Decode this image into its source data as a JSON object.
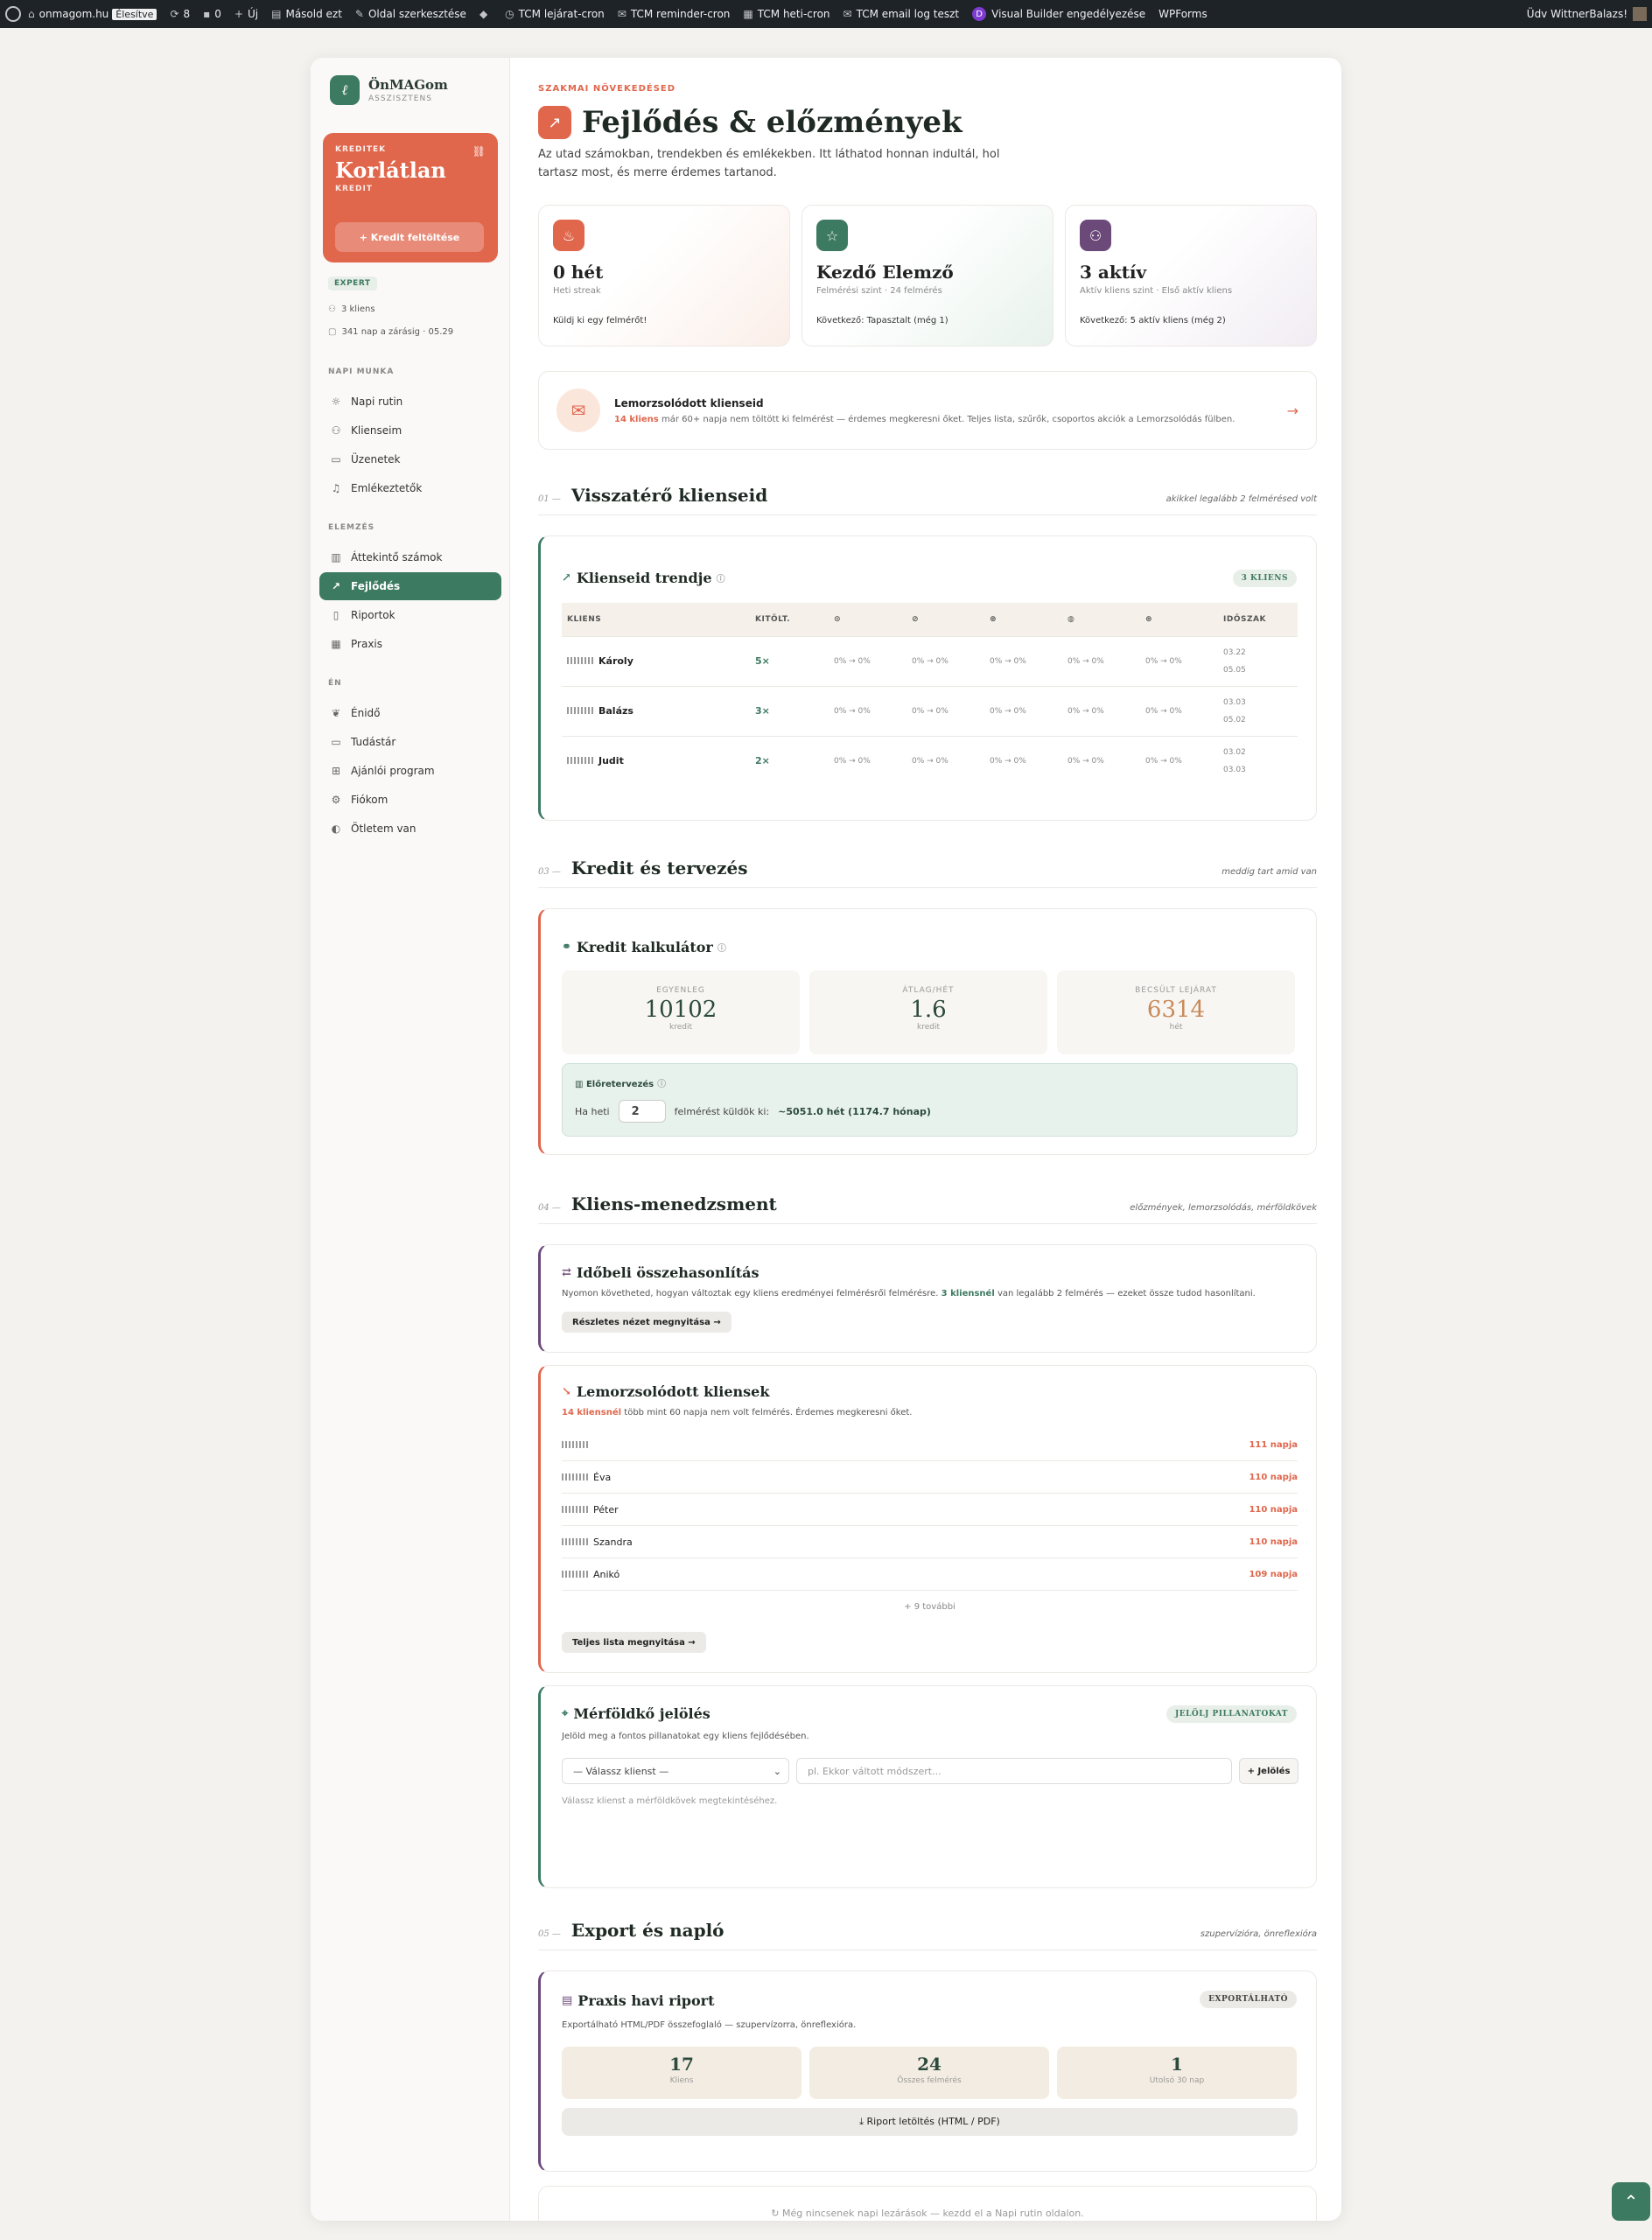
{
  "adminbar": {
    "site": "onmagom.hu",
    "live": "Élesítve",
    "updates": "8",
    "comments": "0",
    "new": "Új",
    "copy": "Másold ezt",
    "edit": "Oldal szerkesztése",
    "items": [
      "TCM lejárat-cron",
      "TCM reminder-cron",
      "TCM heti-cron",
      "TCM email log teszt"
    ],
    "visual_builder": "Visual Builder engedélyezése",
    "wpforms": "WPForms",
    "greeting": "Üdv WittnerBalazs!"
  },
  "brand": {
    "name": "ÖnMAGom",
    "sub": "ASSZISZTENS",
    "logo": "ℓ"
  },
  "credit": {
    "label": "KREDITEK",
    "value": "Korlátlan",
    "unit": "KREDIT",
    "button": "+ Kredit feltöltése"
  },
  "plan": {
    "badge": "EXPERT",
    "clients": "3 kliens",
    "expiry": "341 nap a zárásig · 05.29"
  },
  "nav": {
    "sections": [
      "NAPI MUNKA",
      "ELEMZÉS",
      "ÉN"
    ],
    "items": [
      {
        "label": "Napi rutin",
        "icon": "sun-icon"
      },
      {
        "label": "Klienseim",
        "icon": "users-icon"
      },
      {
        "label": "Üzenetek",
        "icon": "message-icon"
      },
      {
        "label": "Emlékeztetők",
        "icon": "bell-icon"
      },
      {
        "label": "Áttekintő számok",
        "icon": "bar-chart-icon"
      },
      {
        "label": "Fejlődés",
        "icon": "trend-icon"
      },
      {
        "label": "Riportok",
        "icon": "file-icon"
      },
      {
        "label": "Praxis",
        "icon": "building-icon"
      },
      {
        "label": "Énidő",
        "icon": "leaf-icon"
      },
      {
        "label": "Tudástár",
        "icon": "book-icon"
      },
      {
        "label": "Ajánlói program",
        "icon": "gift-icon"
      },
      {
        "label": "Fiókom",
        "icon": "gear-icon"
      },
      {
        "label": "Ötletem van",
        "icon": "bulb-icon"
      }
    ]
  },
  "header": {
    "eyebrow": "SZAKMAI NÖVEKEDÉSED",
    "title": "Fejlődés & előzmények",
    "lead": "Az utad számokban, trendekben és emlékekben. Itt láthatod honnan indultál, hol tartasz most, és merre érdemes tartanod."
  },
  "stats": [
    {
      "value": "0 hét",
      "sub": "Heti streak",
      "foot": "Küldj ki egy felmérőt!",
      "color": "#e0664c",
      "icon": "flame-icon"
    },
    {
      "value": "Kezdő Elemző",
      "sub": "Felmérési szint · 24 felmérés",
      "foot": "Következő: Tapasztalt (még 1)",
      "color": "#3d7a62",
      "icon": "star-icon"
    },
    {
      "value": "3 aktív",
      "sub": "Aktív kliens szint · Első aktív kliens",
      "foot": "Következő: 5 aktív kliens (még 2)",
      "color": "#6b4a7a",
      "icon": "users-icon"
    }
  ],
  "churn_banner": {
    "title": "Lemorzsolódott klienseid",
    "count": "14 kliens",
    "text": "már 60+ napja nem töltött ki felmérést — érdemes megkeresni őket. Teljes lista, szűrők, csoportos akciók a Lemorzsolódás fülben.",
    "arrow": "→"
  },
  "sections": [
    {
      "num": "01 —",
      "title": "Visszatérő klienseid",
      "right": "akikkel legalább 2 felmérésed volt"
    },
    {
      "num": "03 —",
      "title": "Kredit és tervezés",
      "right": "meddig tart amid van"
    },
    {
      "num": "04 —",
      "title": "Kliens-menedzsment",
      "right": "előzmények, lemorzsolódás, mérföldkövek"
    },
    {
      "num": "05 —",
      "title": "Export és napló",
      "right": "szupervízióra, önreflexióra"
    }
  ],
  "trend": {
    "title": "Klienseid trendje",
    "badge": "3 KLIENS",
    "headers": [
      "KLIENS",
      "KITÖLT.",
      "⊙",
      "⊘",
      "⊕",
      "◍",
      "⊛",
      "IDŐSZAK"
    ],
    "rows": [
      {
        "name": "Károly",
        "count": "5×",
        "vals": [
          "0% → 0%",
          "0% → 0%",
          "0% → 0%",
          "0% → 0%",
          "0% → 0%"
        ],
        "from": "03.22",
        "to": "05.05"
      },
      {
        "name": "Balázs",
        "count": "3×",
        "vals": [
          "0% → 0%",
          "0% → 0%",
          "0% → 0%",
          "0% → 0%",
          "0% → 0%"
        ],
        "from": "03.03",
        "to": "05.02"
      },
      {
        "name": "Judit",
        "count": "2×",
        "vals": [
          "0% → 0%",
          "0% → 0%",
          "0% → 0%",
          "0% → 0%",
          "0% → 0%"
        ],
        "from": "03.02",
        "to": "03.03"
      }
    ]
  },
  "calculator": {
    "title": "Kredit kalkulátor",
    "kpis": [
      {
        "label": "EGYENLEG",
        "value": "10102",
        "unit": "kredit"
      },
      {
        "label": "ÁTLAG/HÉT",
        "value": "1.6",
        "unit": "kredit"
      },
      {
        "label": "BECSÜLT LEJÁRAT",
        "value": "6314",
        "unit": "hét"
      }
    ],
    "forecast_label": "Előretervezés",
    "forecast_pre": "Ha heti",
    "forecast_value": "2",
    "forecast_post": "felmérést küldök ki:",
    "forecast_result": "~5051.0 hét (1174.7 hónap)"
  },
  "compare": {
    "title": "Időbeli összehasonlítás",
    "text_pre": "Nyomon követheted, hogyan változtak egy kliens eredményei felmérésről felmérésre.",
    "count": "3 kliensnél",
    "text_post": "van legalább 2 felmérés — ezeket össze tudod hasonlítani.",
    "button": "Részletes nézet megnyitása →"
  },
  "churned": {
    "title": "Lemorzsolódott kliensek",
    "count": "14 kliensnél",
    "text": "több mint 60 napja nem volt felmérés. Érdemes megkeresni őket.",
    "rows": [
      {
        "name": "",
        "days": "111 napja"
      },
      {
        "name": "Éva",
        "days": "110 napja"
      },
      {
        "name": "Péter",
        "days": "110 napja"
      },
      {
        "name": "Szandra",
        "days": "110 napja"
      },
      {
        "name": "Anikó",
        "days": "109 napja"
      }
    ],
    "more": "+ 9 további",
    "button": "Teljes lista megnyitása →"
  },
  "milestone": {
    "title": "Mérföldkő jelölés",
    "badge": "JELÖLJ PILLANATOKAT",
    "text": "Jelöld meg a fontos pillanatokat egy kliens fejlődésében.",
    "select": "— Válassz klienst —",
    "placeholder": "pl. Ekkor váltott módszert...",
    "button": "+ Jelölés",
    "hint": "Válassz klienst a mérföldkövek megtekintéséhez."
  },
  "report": {
    "title": "Praxis havi riport",
    "badge": "EXPORTÁLHATÓ",
    "text": "Exportálható HTML/PDF összefoglaló — szupervízorra, önreflexióra.",
    "kpis": [
      {
        "value": "17",
        "label": "Kliens"
      },
      {
        "value": "24",
        "label": "Összes felmérés"
      },
      {
        "value": "1",
        "label": "Utolsó 30 nap"
      }
    ],
    "download": "⤓  Riport letöltés (HTML / PDF)"
  },
  "empty_note": "↻ Még nincsenek napi lezárások — kezdd el a Napi rutin oldalon."
}
